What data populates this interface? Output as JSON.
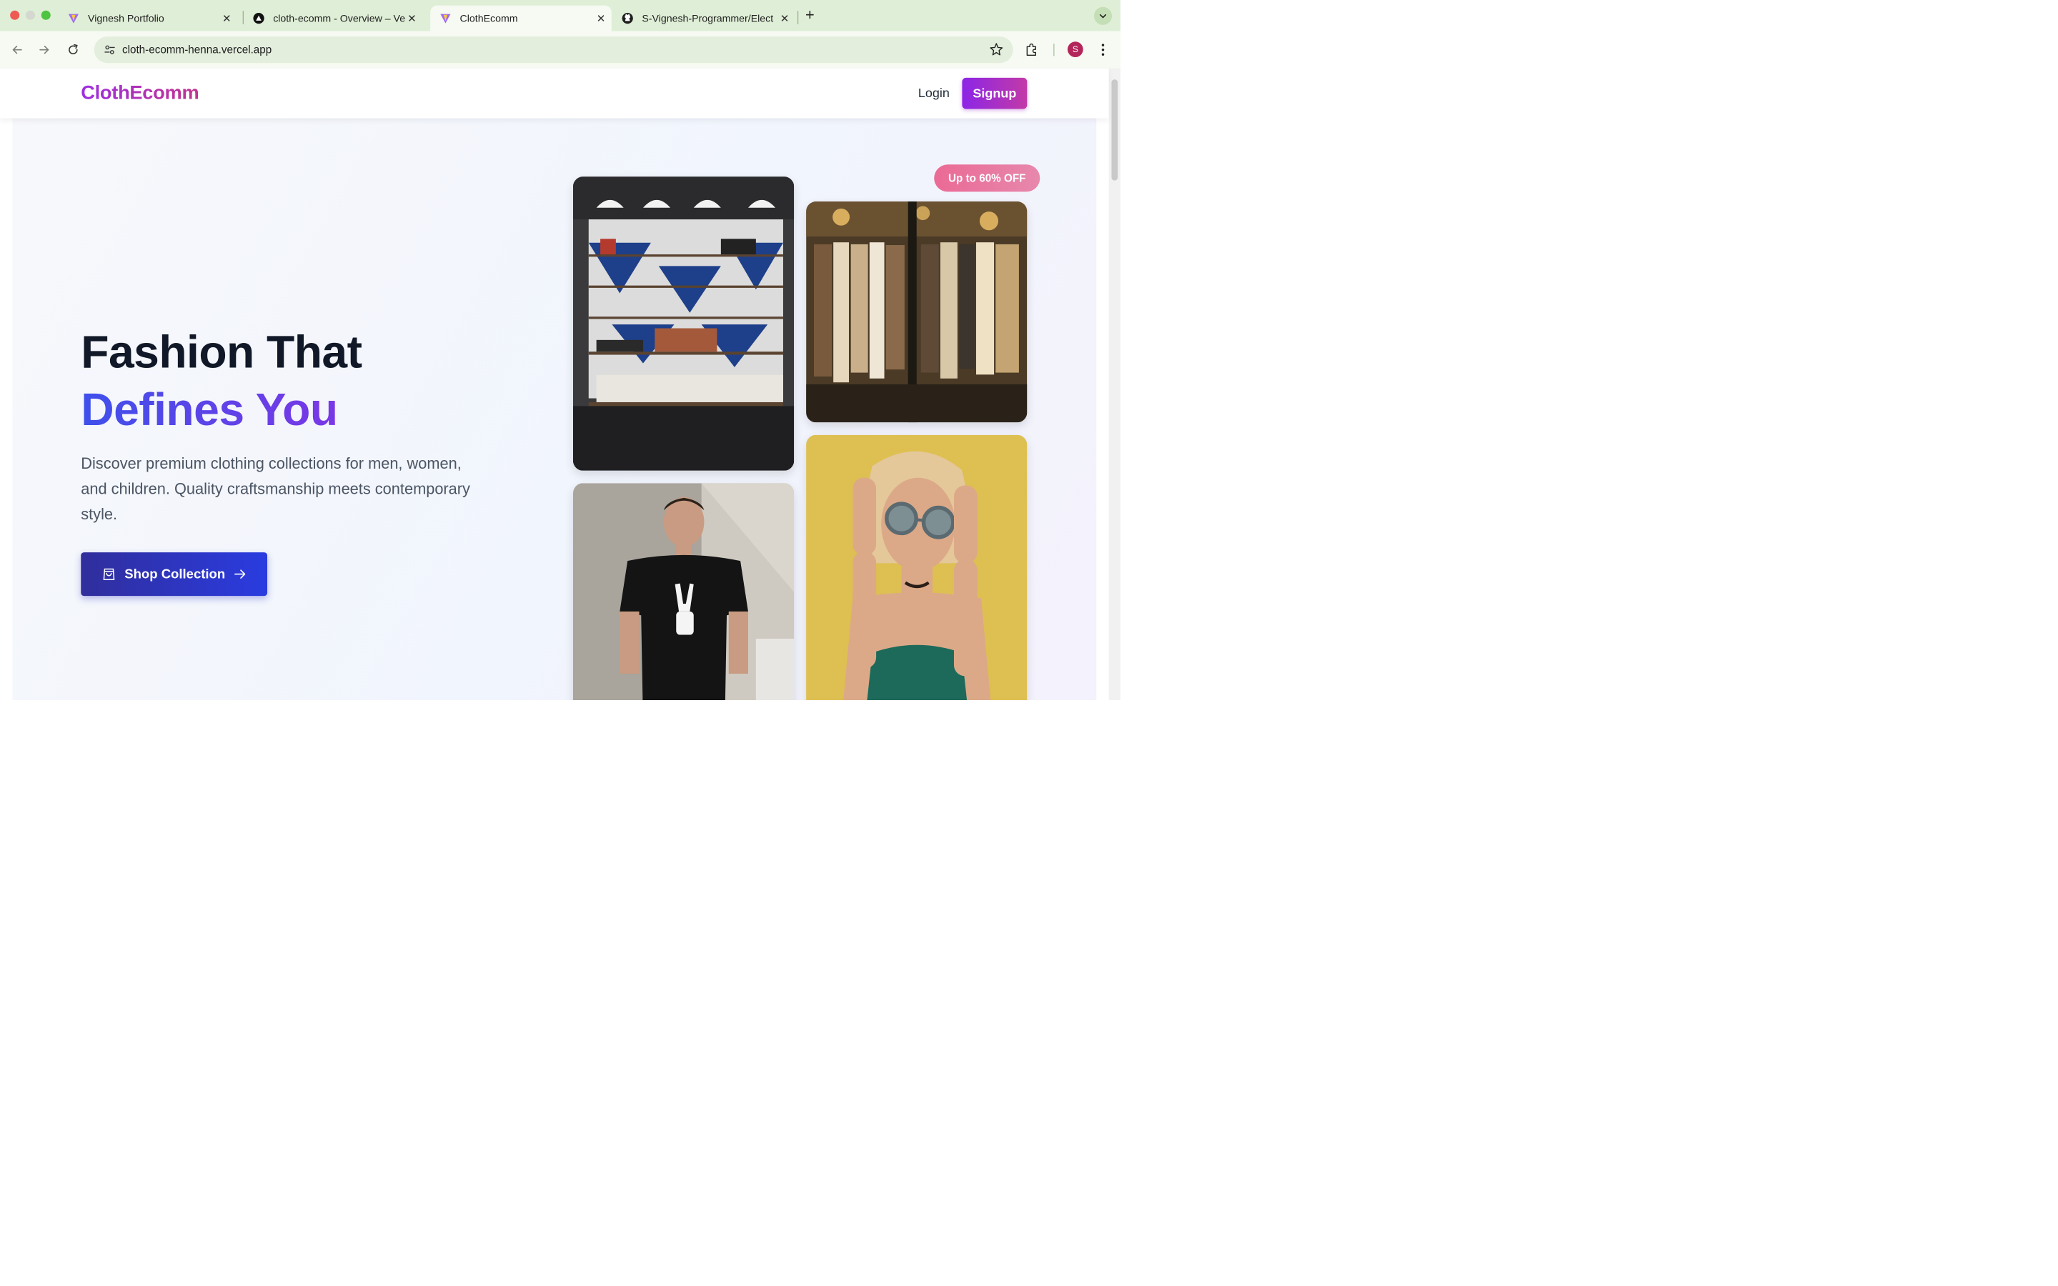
{
  "browser": {
    "tabs": [
      {
        "title": "Vignesh Portfolio",
        "icon": "vite-logo-icon",
        "active": false
      },
      {
        "title": "cloth-ecomm - Overview – Ve",
        "icon": "vercel-logo-icon",
        "active": false
      },
      {
        "title": "ClothEcomm",
        "icon": "vite-logo-icon",
        "active": true
      },
      {
        "title": "S-Vignesh-Programmer/Elect",
        "icon": "github-logo-icon",
        "active": false
      }
    ],
    "url": "cloth-ecomm-henna.vercel.app",
    "profile_initial": "S",
    "colors": {
      "chrome_bg": "#dfeed6",
      "toolbar_bg": "#f6faf2",
      "profile": "#b3265a"
    }
  },
  "site": {
    "logo": "ClothEcomm",
    "nav": {
      "login_label": "Login",
      "signup_label": "Signup"
    },
    "hero": {
      "title_line1": "Fashion That",
      "title_line2": "Defines You",
      "description": "Discover premium clothing collections for men, women, and children. Quality craftsmanship meets contemporary style.",
      "cta_label": "Shop Collection",
      "badge": "Up to 60% OFF",
      "images": [
        {
          "name": "store-interior-image",
          "subject": "boutique shelves with bags and shoes"
        },
        {
          "name": "clothing-rack-image",
          "subject": "clothes hanging on a rack"
        },
        {
          "name": "man-tshirt-image",
          "subject": "man in black skeleton-hand t-shirt"
        },
        {
          "name": "woman-sunglasses-image",
          "subject": "woman with round sunglasses against yellow wall"
        }
      ]
    },
    "colors": {
      "logo_gradient": [
        "#9d2ee0",
        "#c2348f"
      ],
      "signup_gradient": [
        "#8c25e6",
        "#c23aa7"
      ],
      "headline_dark": "#111827",
      "headline_accent": [
        "#3f50ea",
        "#7a37e6"
      ],
      "cta_gradient": [
        "#312e9c",
        "#2a3ce0"
      ],
      "badge": "#ea5f8d"
    }
  }
}
